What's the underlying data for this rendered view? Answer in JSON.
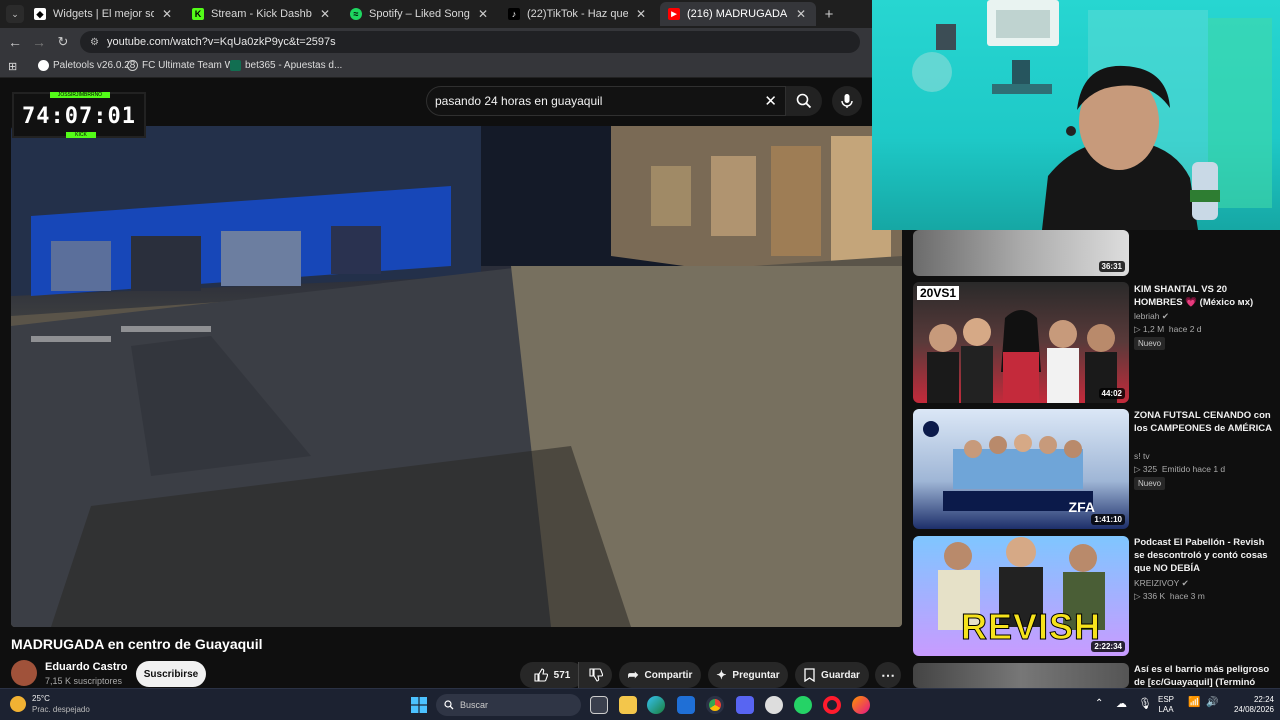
{
  "browser": {
    "tabs": [
      {
        "title": "Widgets | El mejor software para",
        "color": "#ffffff",
        "active": false
      },
      {
        "title": "Stream - Kick Dashboard",
        "color": "#53fc18",
        "active": false
      },
      {
        "title": "Spotify – Liked Songs",
        "color": "#1ed760",
        "active": false
      },
      {
        "title": "(22)TikTok - Haz que tu día sea",
        "color": "#000000",
        "active": false
      },
      {
        "title": "(216) MADRUGADA en centro de",
        "color": "#ff0000",
        "active": true
      }
    ],
    "new_tab_glyph": "+",
    "url": "youtube.com/watch?v=KqUa0zkP9yc&t=2597s",
    "bookmarks": [
      {
        "label": "Paletools v26.0.28",
        "color": "#ffffff"
      },
      {
        "label": "FC Ultimate Team W...",
        "color": "#ffffff"
      },
      {
        "label": "bet365 - Apuestas d...",
        "color": "#126e51"
      }
    ]
  },
  "youtube": {
    "search_query": "pasando 24 horas en guayaquil",
    "video_title": "MADRUGADA en centro de Guayaquil",
    "channel": "Eduardo Castro",
    "subscribers": "7,15 K suscriptores",
    "subscribe_label": "Suscribirse",
    "likes": "571",
    "share_label": "Compartir",
    "ask_label": "Preguntar",
    "save_label": "Guardar"
  },
  "overlay": {
    "timer": "74:07:01",
    "top_label": "JOSSIRJIMBRRNO",
    "bottom_label": "KICK"
  },
  "recommendations": [
    {
      "title": "",
      "channel": "",
      "views": "",
      "age": "",
      "duration": "36:31",
      "badge": ""
    },
    {
      "title": "KIM SHANTAL VS 20 HOMBRES 💗 (México ᴍx)",
      "channel": "lebriah",
      "views": "1,2 M",
      "age": "hace 2 d",
      "duration": "44:02",
      "badge": "Nuevo",
      "thumb_text": "20VS1"
    },
    {
      "title": "ZONA FUTSAL CENANDO con los CAMPEONES de AMÉRICA",
      "channel": "s! tv",
      "views": "325",
      "age": "Emitido hace 1 d",
      "duration": "1:41:10",
      "badge": "Nuevo",
      "thumb_text": "ZFA"
    },
    {
      "title": "Podcast El Pabellón - Revish se descontroló y contó cosas que NO DEBÍA",
      "channel": "KREIZIVOY",
      "views": "336 K",
      "age": "hace 3 m",
      "duration": "2:22:34",
      "badge": "",
      "thumb_text": "REVISH"
    },
    {
      "title": "Así es el barrio más peligroso de [ɛc/Guayaquil] (Terminó",
      "channel": "",
      "views": "",
      "age": "",
      "duration": "",
      "badge": ""
    }
  ],
  "taskbar": {
    "weather_temp": "25°C",
    "weather_desc": "Prac. despejado",
    "search_placeholder": "Buscar",
    "lang1": "ESP",
    "lang2": "LAA",
    "time": "22:24",
    "date": "24/08/2026"
  }
}
